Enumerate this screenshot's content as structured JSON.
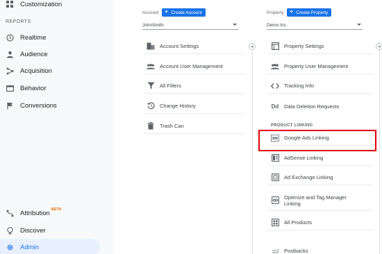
{
  "sidebar": {
    "customization": "Customization",
    "reports_section": "REPORTS",
    "realtime": "Realtime",
    "audience": "Audience",
    "acquisition": "Acquisition",
    "behavior": "Behavior",
    "conversions": "Conversions",
    "attribution": "Attribution",
    "attribution_badge": "BETA",
    "discover": "Discover",
    "admin": "Admin"
  },
  "account": {
    "label": "Account",
    "create_button": "Create Account",
    "selected": "JohnSmith",
    "items": [
      "Account Settings",
      "Account User Management",
      "All Filters",
      "Change History",
      "Trash Can"
    ]
  },
  "property": {
    "label": "Property",
    "create_button": "Create Property",
    "selected": "Demo Inc.",
    "items": [
      "Property Settings",
      "Property User Management",
      "Tracking Info",
      "Data Deletion Requests"
    ],
    "product_linking_label": "PRODUCT LINKING",
    "linking_items": [
      "Google Ads Linking",
      "AdSense Linking",
      "Ad Exchange Linking",
      "Optimize and Tag Manager Linking",
      "All Products"
    ],
    "postbacks": "Postbacks"
  },
  "colors": {
    "accent": "#1a73e8",
    "highlight": "#e00000",
    "sidebar_bg": "#f8f9fa"
  }
}
